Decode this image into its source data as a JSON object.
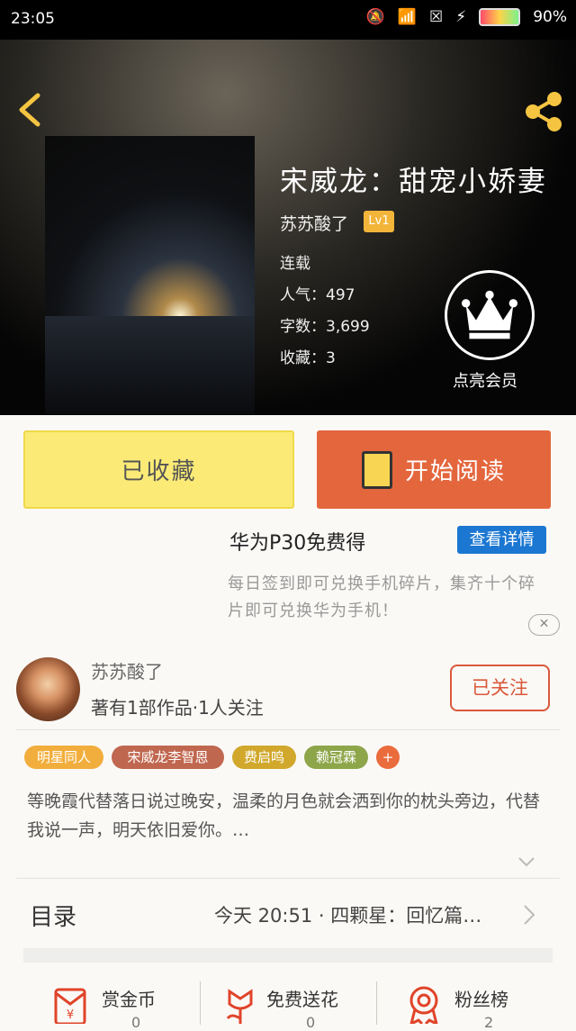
{
  "status_bar": {
    "time": "23:05",
    "battery": "90%"
  },
  "book": {
    "title": "宋威龙：甜宠小娇妻",
    "author": "苏苏酸了",
    "level": "Lv1",
    "status": "连载",
    "popularity": "人气：497",
    "word_count": "字数：3,699",
    "favorites": "收藏：3"
  },
  "vip": {
    "label": "点亮会员"
  },
  "actions": {
    "collect_label": "已收藏",
    "read_label": "开始阅读"
  },
  "promo": {
    "title": "华为P30免费得",
    "button": "查看详情",
    "description": "每日签到即可兑换手机碎片，集齐十个碎片即可兑换华为手机！",
    "close": "✕"
  },
  "author_card": {
    "name": "苏苏酸了",
    "stats": "著有1部作品·1人关注",
    "follow_label": "已关注"
  },
  "tags": [
    {
      "label": "明星同人",
      "color": "#f2ae3c"
    },
    {
      "label": "宋威龙李智恩",
      "color": "#c0674f"
    },
    {
      "label": "费启鸣",
      "color": "#d1a82c"
    },
    {
      "label": "赖冠霖",
      "color": "#8ea64a"
    },
    {
      "label": "+",
      "color": "#ea6b3b"
    }
  ],
  "description": "等晚霞代替落日说过晚安，温柔的月色就会洒到你的枕头旁边，代替我说一声，明天依旧爱你。…",
  "toc": {
    "label": "目录",
    "latest": "今天 20:51 · 四颗星：回忆篇…"
  },
  "bottom": [
    {
      "label": "赏金币",
      "count": "0"
    },
    {
      "label": "免费送花",
      "count": "0"
    },
    {
      "label": "粉丝榜",
      "count": "2"
    }
  ]
}
